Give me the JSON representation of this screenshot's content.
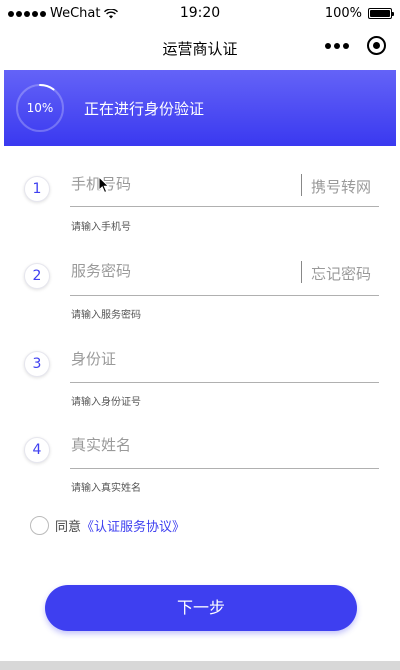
{
  "status_bar": {
    "carrier": "WeChat",
    "time": "19:20",
    "battery": "100%"
  },
  "nav": {
    "title": "运营商认证"
  },
  "banner": {
    "progress_label": "10%",
    "progress_value": 0.1,
    "title": "正在进行身份验证"
  },
  "form": {
    "fields": [
      {
        "step": "1",
        "placeholder": "手机号码",
        "link": "携号转网",
        "hint": "请输入手机号"
      },
      {
        "step": "2",
        "placeholder": "服务密码",
        "link": "忘记密码",
        "hint": "请输入服务密码"
      },
      {
        "step": "3",
        "placeholder": "身份证",
        "link": "",
        "hint": "请输入身份证号"
      },
      {
        "step": "4",
        "placeholder": "真实姓名",
        "link": "",
        "hint": "请输入真实姓名"
      }
    ]
  },
  "agreement": {
    "prefix": "同意",
    "link": "《认证服务协议》"
  },
  "next_button": {
    "label": "下一步"
  },
  "colors": {
    "accent": "#3e3ff0",
    "banner_top": "#6463f7",
    "banner_bottom": "#3a39f0"
  }
}
